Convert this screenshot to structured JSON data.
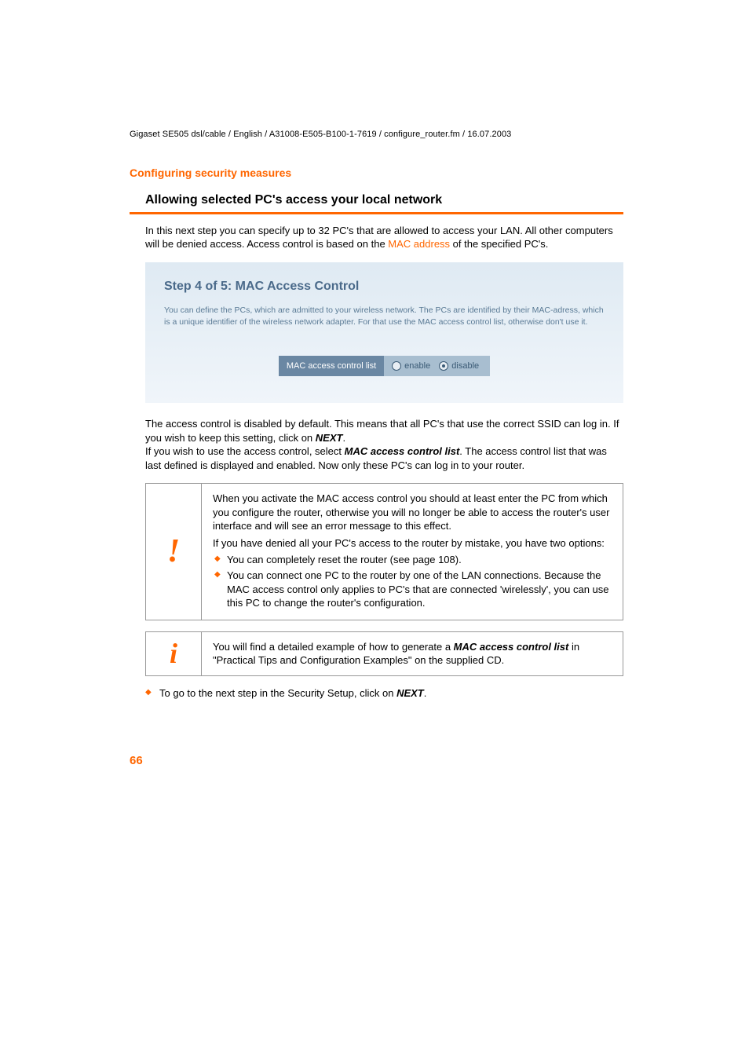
{
  "header": {
    "path": "Gigaset SE505 dsl/cable / English / A31008-E505-B100-1-7619 / configure_router.fm / 16.07.2003"
  },
  "section": {
    "title": "Configuring security measures",
    "subheading": "Allowing selected PC's access your local network"
  },
  "intro": {
    "part1": "In this next step you can specify up to 32 PC's that are allowed to access your LAN. All other computers will be denied access. Access control is based on the ",
    "link": "MAC address",
    "part2": " of the specified PC's."
  },
  "screenshot": {
    "title": "Step 4 of 5: MAC Access Control",
    "desc": "You can define the PCs, which are admitted to your wireless network. The PCs are identified by their MAC-adress, which is a unique identifier of the wireless network adapter. For that use the MAC access control list, otherwise don't use it.",
    "control_label": "MAC access control list",
    "opt_enable": "enable",
    "opt_disable": "disable"
  },
  "para2": {
    "t1": "The access control is disabled by default. This means that all PC's that use the correct SSID can log in. If you wish to keep this setting, click on ",
    "next": "NEXT",
    "t2": ".",
    "t3": "If you wish to use the access control, select ",
    "mac_label": "MAC access control list",
    "t4": ". The access control list that was last defined is displayed and enabled. Now only these PC's can log in to your router."
  },
  "warning": {
    "p1": "When you activate the MAC access control you should at least enter the PC from which you configure the router, otherwise you will no longer be able to access the router's user interface and will see an error message to this effect.",
    "p2": "If you have denied all your PC's access to the router by mistake, you have two options:",
    "b1": "You can completely reset the router (see page 108).",
    "b2": "You can connect one PC to the router by one of the LAN connections. Because the MAC access control only applies to PC's that are connected 'wirelessly', you can use this PC to change the router's configuration."
  },
  "info": {
    "t1": "You will find a detailed example of how to generate a ",
    "mac": "MAC access control list",
    "t2": " in \"Practical Tips and Configuration Examples\" on the supplied CD."
  },
  "final": {
    "t1": "To go to the next step in the Security Setup, click on ",
    "next": "NEXT",
    "t2": "."
  },
  "page_number": "66"
}
